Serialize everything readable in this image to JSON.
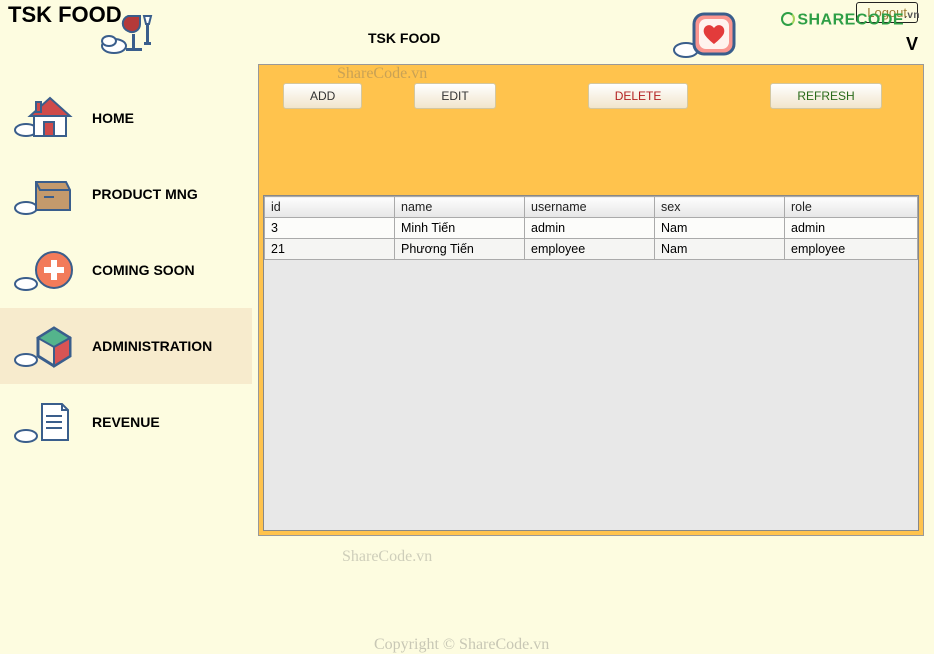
{
  "header": {
    "app_title": "TSK FOOD",
    "app_subtitle": "TSK FOOD",
    "logout_label": "Logout",
    "sharecode": "SHARECODE",
    "sharecode_tld": ".vn",
    "big_v": "V"
  },
  "sidebar": {
    "items": [
      {
        "label": "HOME"
      },
      {
        "label": "PRODUCT MNG"
      },
      {
        "label": "COMING SOON"
      },
      {
        "label": "ADMINISTRATION"
      },
      {
        "label": "REVENUE"
      }
    ]
  },
  "toolbar": {
    "add_label": "ADD",
    "edit_label": "EDIT",
    "delete_label": "DELETE",
    "refresh_label": "REFRESH"
  },
  "table": {
    "columns": [
      "id",
      "name",
      "username",
      "sex",
      "role"
    ],
    "rows": [
      {
        "id": "3",
        "name": "Minh Tiến",
        "username": "admin",
        "sex": "Nam",
        "role": "admin"
      },
      {
        "id": "21",
        "name": "Phương Tiến",
        "username": "employee",
        "sex": "Nam",
        "role": "employee"
      }
    ]
  },
  "watermarks": {
    "sharecode": "ShareCode.vn",
    "copyright": "Copyright © ShareCode.vn"
  }
}
